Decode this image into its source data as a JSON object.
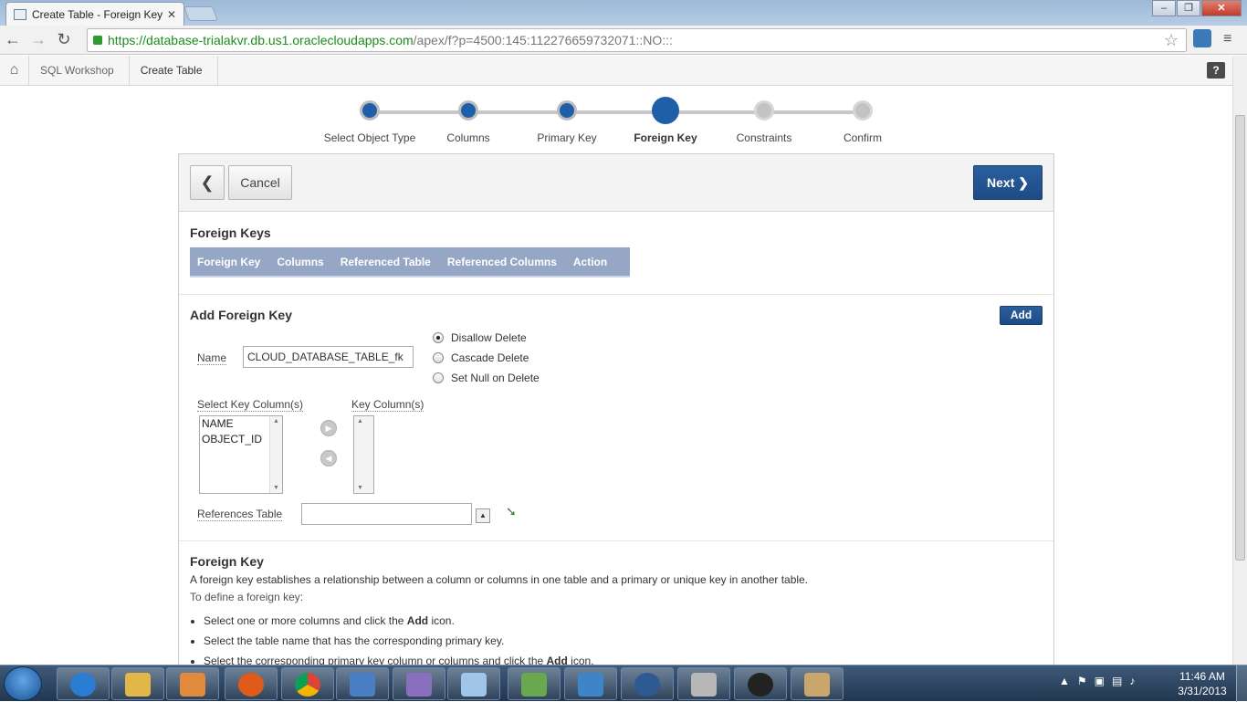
{
  "browser": {
    "tab_title": "Create Table - Foreign Key",
    "tab_close": "✕",
    "url_scheme": "https://",
    "url_host": "database-trialakvr.db.us1.oraclecloudapps.com",
    "url_path": "/apex/f?p=4500:145:112276659732071::NO:::"
  },
  "breadcrumb": {
    "items": [
      "SQL Workshop",
      "Create Table"
    ]
  },
  "help_label": "?",
  "wizard": {
    "steps": [
      {
        "label": "Select Object Type",
        "state": "done"
      },
      {
        "label": "Columns",
        "state": "done"
      },
      {
        "label": "Primary Key",
        "state": "done"
      },
      {
        "label": "Foreign Key",
        "state": "current"
      },
      {
        "label": "Constraints",
        "state": "todo"
      },
      {
        "label": "Confirm",
        "state": "todo"
      }
    ]
  },
  "buttons": {
    "back": "❮",
    "cancel": "Cancel",
    "next": "Next ❯",
    "add": "Add",
    "move_right": "▶",
    "move_left": "◀",
    "lov": "▲"
  },
  "foreign_keys": {
    "title": "Foreign Keys",
    "columns": [
      "Foreign Key",
      "Columns",
      "Referenced Table",
      "Referenced Columns",
      "Action"
    ]
  },
  "add_fk": {
    "title": "Add Foreign Key",
    "name_label": "Name",
    "name_value": "CLOUD_DATABASE_TABLE_fk",
    "delete_options": [
      {
        "label": "Disallow Delete",
        "checked": true
      },
      {
        "label": "Cascade Delete",
        "checked": false
      },
      {
        "label": "Set Null on Delete",
        "checked": false
      }
    ],
    "select_key_label": "Select Key Column(s)",
    "select_key_options": [
      "NAME",
      "OBJECT_ID"
    ],
    "key_columns_label": "Key Column(s)",
    "references_table_label": "References Table",
    "references_table_value": ""
  },
  "help_section": {
    "title": "Foreign Key",
    "intro": "A foreign key establishes a relationship between a column or columns in one table and a primary or unique key in another table.",
    "subintro": "To define a foreign key:",
    "bullets": [
      {
        "pre": "Select one or more columns and click the ",
        "bold": "Add",
        "post": " icon."
      },
      {
        "pre": "Select the table name that has the corresponding primary key.",
        "bold": "",
        "post": ""
      },
      {
        "pre": "Select the corresponding primary key column or columns and click the ",
        "bold": "Add",
        "post": " icon."
      }
    ]
  },
  "taskbar": {
    "time": "11:46 AM",
    "date": "3/31/2013",
    "apps": [
      "internet-explorer",
      "file-explorer",
      "media-player",
      "firefox",
      "chrome",
      "network-tool",
      "pidgin",
      "notepad",
      "editor",
      "spreadsheet",
      "thunderbird",
      "calculator",
      "pasteboard",
      "paint"
    ]
  }
}
